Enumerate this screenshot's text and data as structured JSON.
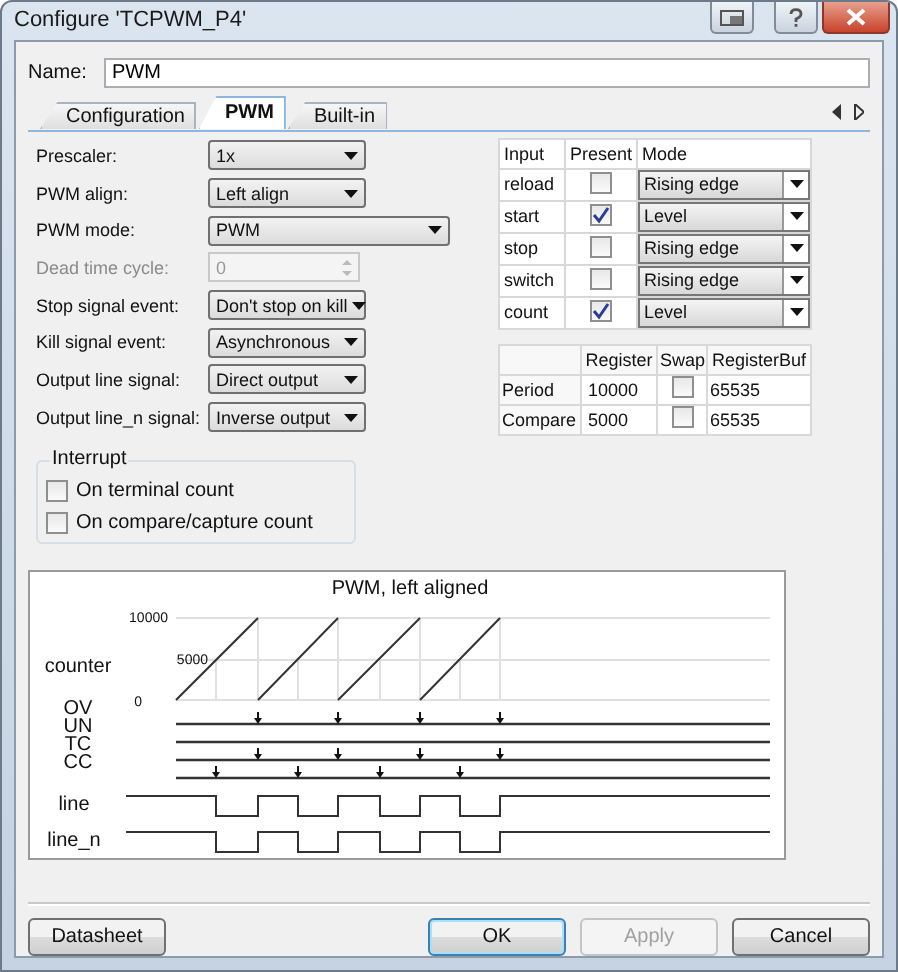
{
  "window": {
    "title": "Configure 'TCPWM_P4'"
  },
  "name_field": {
    "label": "Name:",
    "value": "PWM"
  },
  "tabs": [
    {
      "label": "Configuration",
      "selected": false
    },
    {
      "label": "PWM",
      "selected": true
    },
    {
      "label": "Built-in",
      "selected": false
    }
  ],
  "settings": [
    {
      "kind": "dropdown",
      "label": "Prescaler:",
      "value": "1x",
      "disabled": false
    },
    {
      "kind": "dropdown",
      "label": "PWM align:",
      "value": "Left align",
      "disabled": false
    },
    {
      "kind": "dropdown",
      "label": "PWM mode:",
      "value": "PWM",
      "disabled": false
    },
    {
      "kind": "spinner",
      "label": "Dead time cycle:",
      "value": "0",
      "disabled": true
    },
    {
      "kind": "dropdown",
      "label": "Stop signal event:",
      "value": "Don't stop on kill",
      "disabled": false
    },
    {
      "kind": "dropdown",
      "label": "Kill signal event:",
      "value": "Asynchronous",
      "disabled": false
    },
    {
      "kind": "dropdown",
      "label": "Output line signal:",
      "value": "Direct output",
      "disabled": false
    },
    {
      "kind": "dropdown",
      "label": "Output line_n signal:",
      "value": "Inverse output",
      "disabled": false
    }
  ],
  "interrupt": {
    "title": "Interrupt",
    "options": [
      {
        "label": "On terminal count",
        "checked": false
      },
      {
        "label": "On compare/capture count",
        "checked": false
      }
    ]
  },
  "inputs_table": {
    "columns": [
      "Input",
      "Present",
      "Mode"
    ],
    "rows": [
      {
        "input": "reload",
        "present": false,
        "mode": "Rising edge"
      },
      {
        "input": "start",
        "present": true,
        "mode": "Level"
      },
      {
        "input": "stop",
        "present": false,
        "mode": "Rising edge"
      },
      {
        "input": "switch",
        "present": false,
        "mode": "Rising edge"
      },
      {
        "input": "count",
        "present": true,
        "mode": "Level"
      }
    ]
  },
  "registers_table": {
    "columns": [
      "Register",
      "Swap",
      "RegisterBuf"
    ],
    "rows": [
      {
        "name": "Period",
        "register": "10000",
        "swap": false,
        "buffer": "65535"
      },
      {
        "name": "Compare",
        "register": "5000",
        "swap": false,
        "buffer": "65535"
      }
    ]
  },
  "diagram": {
    "title": "PWM, left aligned",
    "counter_label": "counter",
    "y_ticks": [
      "10000",
      "5000",
      "0"
    ],
    "signals": [
      "OV",
      "UN",
      "TC",
      "CC"
    ],
    "outputs": [
      "line",
      "line_n"
    ]
  },
  "buttons": [
    {
      "label": "Datasheet",
      "default": false,
      "disabled": false
    },
    {
      "label": "OK",
      "default": true,
      "disabled": false
    },
    {
      "label": "Apply",
      "default": false,
      "disabled": true
    },
    {
      "label": "Cancel",
      "default": false,
      "disabled": false
    }
  ]
}
